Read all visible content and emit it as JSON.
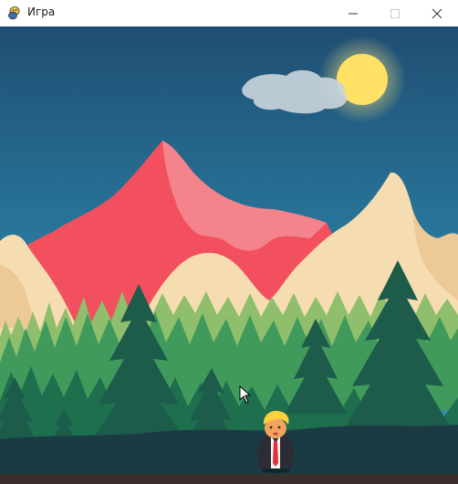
{
  "window": {
    "title": "Игра",
    "app_icon": "pygame-snake-icon",
    "controls": [
      "minimize-icon",
      "maximize-icon",
      "close-icon"
    ]
  },
  "scene": {
    "background": "mountain-forest-landscape",
    "sun": "sun",
    "cloud": "cloud",
    "player_character": "trump-caricature-sprite",
    "cursor": "mouse-pointer-icon"
  },
  "colors": {
    "sky_top": "#1f4e72",
    "sky_mid": "#2a7ea3",
    "sun": "#ffe165",
    "red_mountain": "#f2505e",
    "red_mountain_light": "#f3848b",
    "cream_mountain": "#f6dcb1",
    "forest_light": "#8fbe6c",
    "forest_mid": "#3f9a5c",
    "forest_dark": "#1e6f4e",
    "ground": "#1a3b44"
  }
}
